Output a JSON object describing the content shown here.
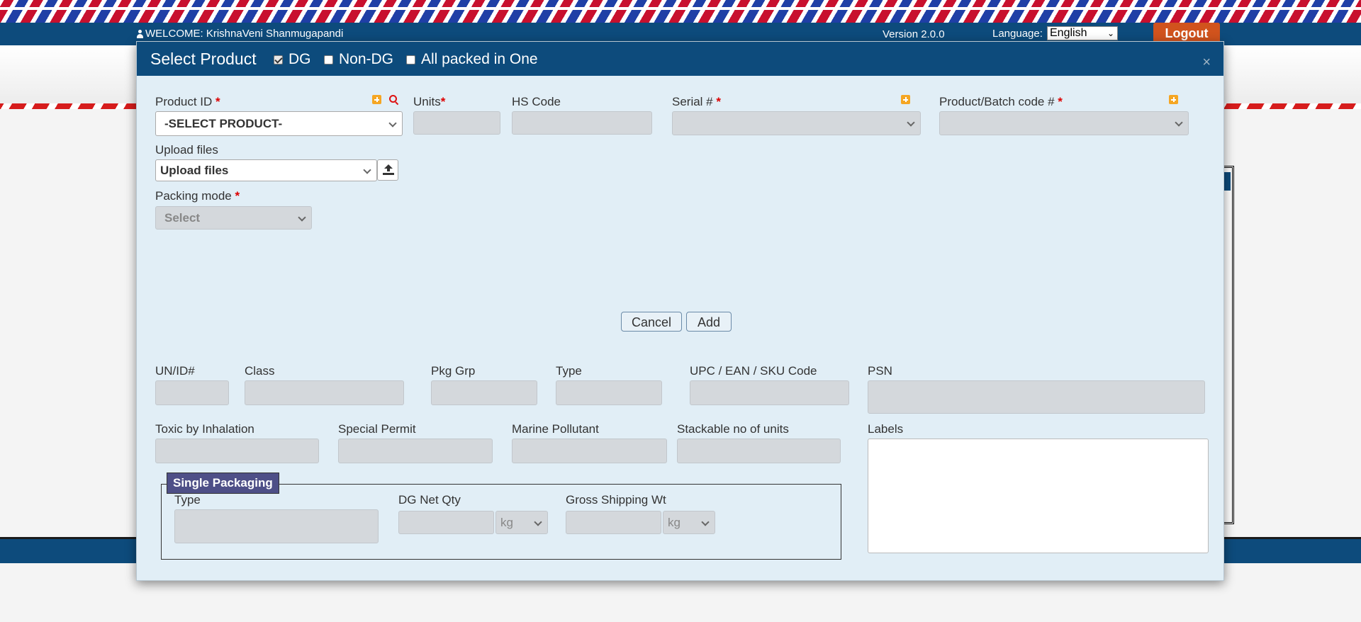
{
  "topbar": {
    "welcome": "WELCOME: KrishnaVeni Shanmugapandi",
    "version": "Version 2.0.0",
    "language_label": "Language:",
    "language_value": "English",
    "logout_label": "Logout"
  },
  "modal": {
    "title": "Select Product",
    "checks": [
      {
        "label": "DG",
        "checked": true
      },
      {
        "label": "Non-DG",
        "checked": false
      },
      {
        "label": "All packed in One",
        "checked": false
      }
    ],
    "close": "×",
    "product_id": {
      "label": "Product ID",
      "req": "*",
      "value": "-SELECT PRODUCT-"
    },
    "units": {
      "label": "Units",
      "req": "*"
    },
    "hs_code": {
      "label": "HS Code"
    },
    "serial": {
      "label": "Serial #",
      "req": "*"
    },
    "batch": {
      "label": "Product/Batch code #",
      "req": "*"
    },
    "upload": {
      "label": "Upload files",
      "value": "Upload files"
    },
    "packing_mode": {
      "label": "Packing mode",
      "req": "*",
      "value": "Select"
    },
    "cancel_label": "Cancel",
    "add_label": "Add",
    "un_id": "UN/ID#",
    "class": "Class",
    "pkg_grp": "Pkg Grp",
    "type": "Type",
    "upc": "UPC / EAN / SKU Code",
    "psn": "PSN",
    "toxic": "Toxic by Inhalation",
    "special_permit": "Special Permit",
    "marine": "Marine Pollutant",
    "stackable": "Stackable no of units",
    "labels": "Labels",
    "single_packaging": {
      "legend": "Single Packaging",
      "type": "Type",
      "dg_net_qty": "DG Net Qty",
      "dg_unit": "kg",
      "gross_wt": "Gross Shipping Wt",
      "gross_unit": "kg"
    }
  }
}
